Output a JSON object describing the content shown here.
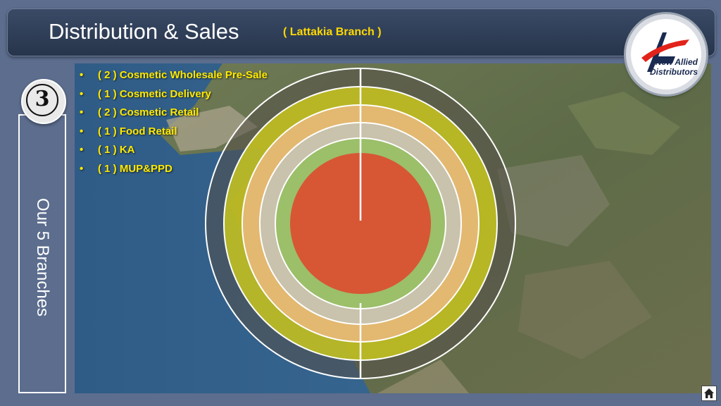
{
  "header": {
    "title": "Distribution & Sales",
    "subtitle": "( Lattakia Branch )"
  },
  "logo": {
    "line1": "New Allied",
    "line2": "Distributors",
    "icon": "a-arrow-icon"
  },
  "badge": {
    "number": "3"
  },
  "side_panel": {
    "label": "Our 5 Branches"
  },
  "bullets": [
    "( 2 )  Cosmetic Wholesale Pre-Sale",
    "( 1 )  Cosmetic Delivery",
    "( 2 )  Cosmetic Retail",
    "( 1 )  Food Retail",
    "( 1 )  KA",
    "( 1 )  MUP&PPD"
  ],
  "bullet_glyph": "•",
  "rings": {
    "colors": [
      "#555049",
      "#c8c51d",
      "#e3b870",
      "#c9c2ac",
      "#9cbf6a",
      "#d75735"
    ],
    "divider_color": "#ffffff"
  },
  "colors": {
    "background": "#5c6d8e",
    "header": "#2d3b52",
    "accent": "#ffd800",
    "bullet_text": "#ffe900"
  },
  "home_button": {
    "icon": "home-icon"
  }
}
